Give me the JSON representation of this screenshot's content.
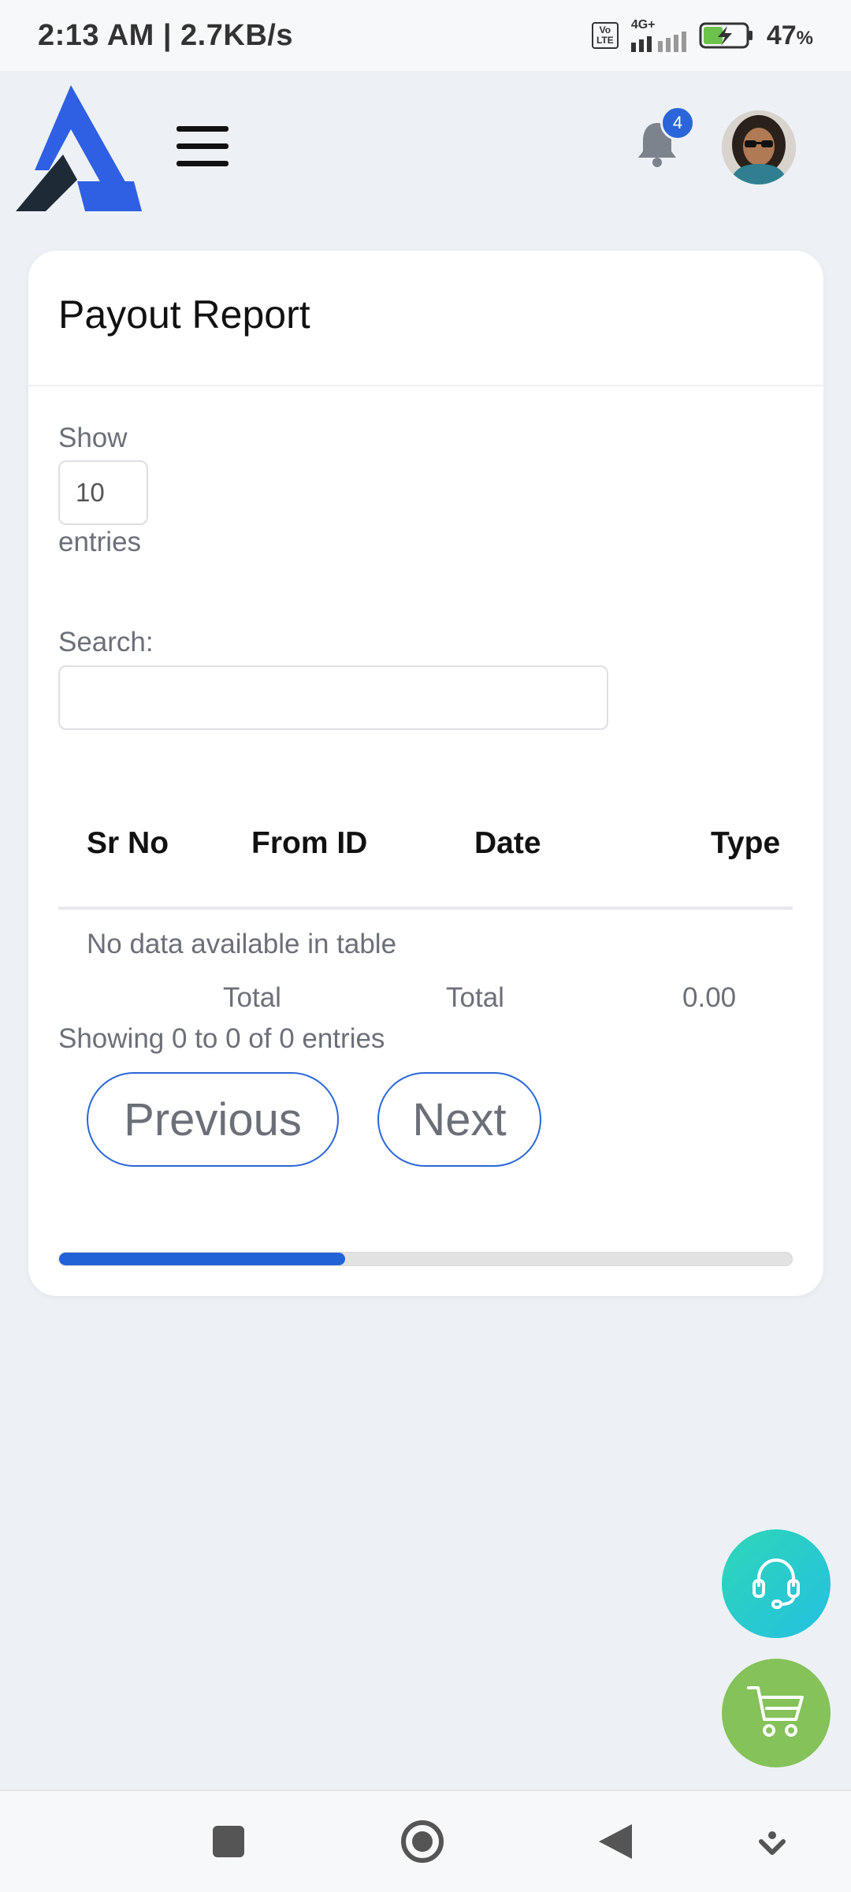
{
  "status_bar": {
    "time_speed": "2:13 AM | 2.7KB/s",
    "volte_top": "Vo",
    "volte_bottom": "LTE",
    "network": "4G+",
    "battery_percent": "47",
    "battery_unit": "%",
    "battery_level": 0.47
  },
  "header": {
    "notification_count": "4",
    "icons": [
      "logo-icon",
      "menu-icon",
      "bell-icon",
      "avatar"
    ]
  },
  "card": {
    "title": "Payout Report",
    "show_label": "Show",
    "entries_value": "10",
    "entries_label": "entries",
    "search_label": "Search:",
    "search_value": ""
  },
  "table": {
    "columns": [
      "Sr No",
      "From ID",
      "Date",
      "Type"
    ],
    "empty_message": "No data available in table",
    "footer": [
      "Total",
      "Total",
      "0.00"
    ],
    "info": "Showing 0 to 0 of 0 entries"
  },
  "pagination": {
    "previous": "Previous",
    "next": "Next"
  },
  "scroll_progress": 0.39,
  "colors": {
    "accent": "#2a66d9",
    "support_fab": "#2fd0c6",
    "cart_fab": "#85c25a",
    "background": "#edf1f6"
  }
}
